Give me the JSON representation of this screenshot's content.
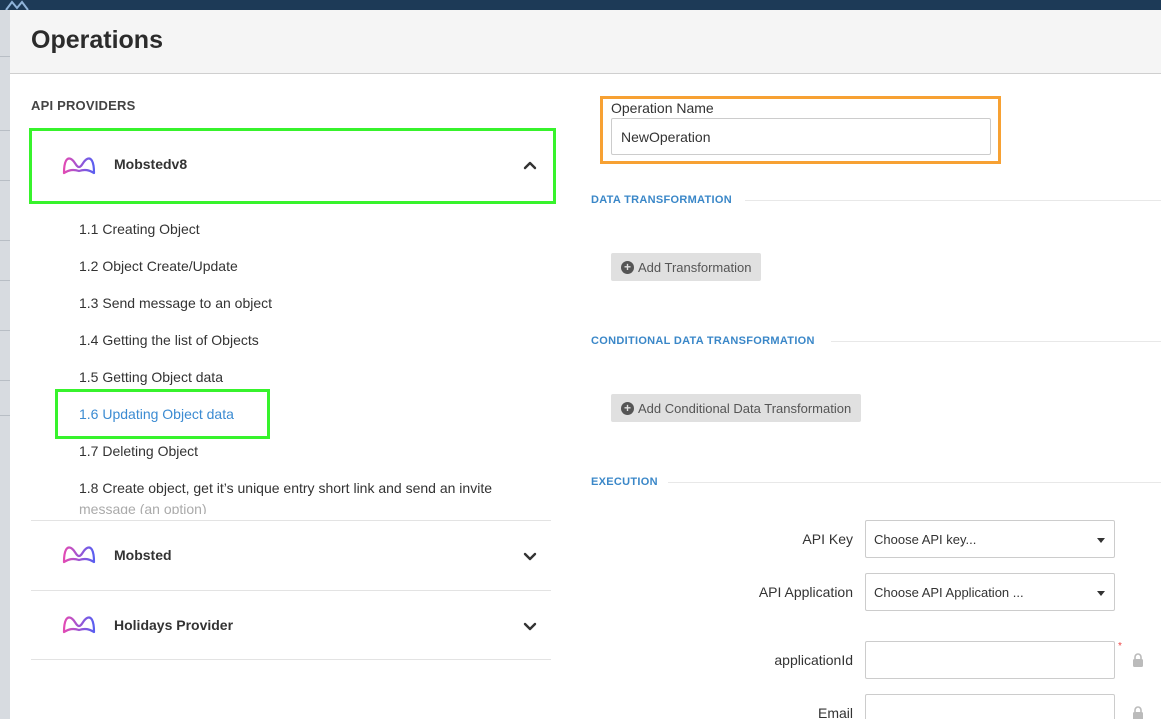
{
  "modal": {
    "title": "Operations"
  },
  "providers": {
    "heading": "API PROVIDERS",
    "items": [
      {
        "name": "Mobstedv8",
        "expanded": true,
        "operations": [
          "1.1 Creating Object",
          "1.2 Object Create/Update",
          "1.3 Send message to an object",
          "1.4 Getting the list of Objects",
          "1.5 Getting Object data",
          "1.6 Updating Object data",
          "1.7 Deleting Object",
          "1.8 Create object, get it’s unique entry short link and send an invite",
          "message (an option)"
        ],
        "active_operation": "1.6 Updating Object data"
      },
      {
        "name": "Mobsted",
        "expanded": false
      },
      {
        "name": "Holidays Provider",
        "expanded": false
      }
    ],
    "chevron_icons": [
      "chevron-up-icon",
      "chevron-down-icon"
    ]
  },
  "operation": {
    "name_label": "Operation Name",
    "name_value": "NewOperation"
  },
  "data_transformation": {
    "heading": "DATA TRANSFORMATION",
    "add_label": "Add Transformation"
  },
  "conditional_transformation": {
    "heading": "CONDITIONAL DATA TRANSFORMATION",
    "add_label": "Add Conditional Data Transformation"
  },
  "execution": {
    "heading": "EXECUTION",
    "api_key_label": "API Key",
    "api_key_value": "Choose API key...",
    "api_app_label": "API Application",
    "api_app_value": "Choose API Application ...",
    "application_id_label": "applicationId",
    "application_id_value": "",
    "required_mark": "*",
    "email_label": "Email",
    "email_value": ""
  },
  "colors": {
    "accent_blue": "#3a87c8",
    "highlight_green": "#37f32c",
    "highlight_orange": "#f7a133",
    "logo_gradient_start": "#e24bb4",
    "logo_gradient_end": "#5a5ef0"
  }
}
